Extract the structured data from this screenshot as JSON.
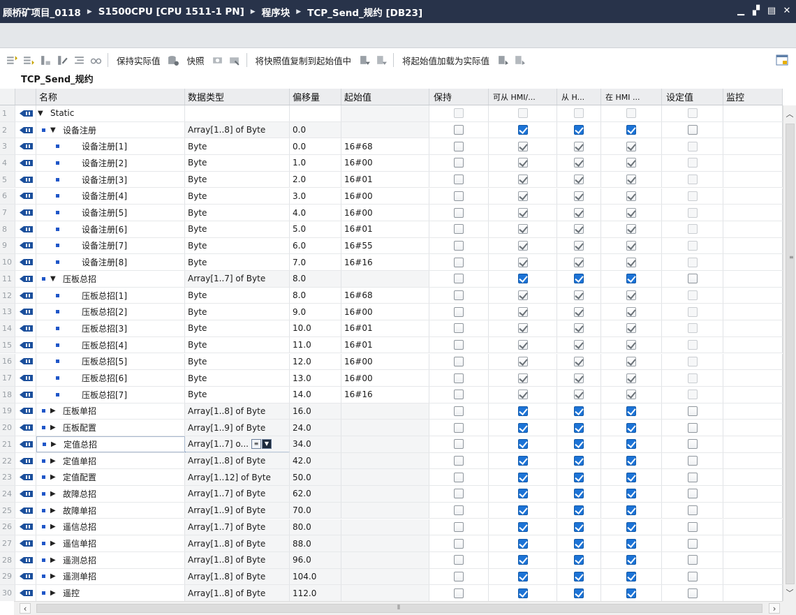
{
  "titlebar": {
    "crumbs": [
      "顾桥矿项目_0118",
      "S1500CPU [CPU 1511-1 PN]",
      "程序块",
      "TCP_Send_规约 [DB23]"
    ]
  },
  "toolbar": {
    "keep_actual": "保持实际值",
    "snapshot": "快照",
    "copy_snapshot": "将快照值复制到起始值中",
    "load_start": "将起始值加载为实际值"
  },
  "block_title": "TCP_Send_规约",
  "columns": [
    "名称",
    "数据类型",
    "偏移量",
    "起始值",
    "保持",
    "可从 HMI/...",
    "从 H...",
    "在 HMI ...",
    "设定值",
    "监控"
  ],
  "rows": [
    {
      "n": "1",
      "level": 0,
      "expand": "down",
      "name": "Static",
      "type": "",
      "off": "",
      "start": "",
      "style": "static"
    },
    {
      "n": "2",
      "level": 1,
      "expand": "down",
      "name": "设备注册",
      "type": "Array[1..8] of Byte",
      "off": "0.0",
      "start": "",
      "style": "parent"
    },
    {
      "n": "3",
      "level": 2,
      "name": "设备注册[1]",
      "type": "Byte",
      "off": "0.0",
      "start": "16#68",
      "style": "child"
    },
    {
      "n": "4",
      "level": 2,
      "name": "设备注册[2]",
      "type": "Byte",
      "off": "1.0",
      "start": "16#00",
      "style": "child"
    },
    {
      "n": "5",
      "level": 2,
      "name": "设备注册[3]",
      "type": "Byte",
      "off": "2.0",
      "start": "16#01",
      "style": "child"
    },
    {
      "n": "6",
      "level": 2,
      "name": "设备注册[4]",
      "type": "Byte",
      "off": "3.0",
      "start": "16#00",
      "style": "child"
    },
    {
      "n": "7",
      "level": 2,
      "name": "设备注册[5]",
      "type": "Byte",
      "off": "4.0",
      "start": "16#00",
      "style": "child"
    },
    {
      "n": "8",
      "level": 2,
      "name": "设备注册[6]",
      "type": "Byte",
      "off": "5.0",
      "start": "16#01",
      "style": "child"
    },
    {
      "n": "9",
      "level": 2,
      "name": "设备注册[7]",
      "type": "Byte",
      "off": "6.0",
      "start": "16#55",
      "style": "child"
    },
    {
      "n": "10",
      "level": 2,
      "name": "设备注册[8]",
      "type": "Byte",
      "off": "7.0",
      "start": "16#16",
      "style": "child"
    },
    {
      "n": "11",
      "level": 1,
      "expand": "down",
      "name": "压板总招",
      "type": "Array[1..7] of Byte",
      "off": "8.0",
      "start": "",
      "style": "parent"
    },
    {
      "n": "12",
      "level": 2,
      "name": "压板总招[1]",
      "type": "Byte",
      "off": "8.0",
      "start": "16#68",
      "style": "child"
    },
    {
      "n": "13",
      "level": 2,
      "name": "压板总招[2]",
      "type": "Byte",
      "off": "9.0",
      "start": "16#00",
      "style": "child"
    },
    {
      "n": "14",
      "level": 2,
      "name": "压板总招[3]",
      "type": "Byte",
      "off": "10.0",
      "start": "16#01",
      "style": "child"
    },
    {
      "n": "15",
      "level": 2,
      "name": "压板总招[4]",
      "type": "Byte",
      "off": "11.0",
      "start": "16#01",
      "style": "child"
    },
    {
      "n": "16",
      "level": 2,
      "name": "压板总招[5]",
      "type": "Byte",
      "off": "12.0",
      "start": "16#00",
      "style": "child"
    },
    {
      "n": "17",
      "level": 2,
      "name": "压板总招[6]",
      "type": "Byte",
      "off": "13.0",
      "start": "16#00",
      "style": "child"
    },
    {
      "n": "18",
      "level": 2,
      "name": "压板总招[7]",
      "type": "Byte",
      "off": "14.0",
      "start": "16#16",
      "style": "child"
    },
    {
      "n": "19",
      "level": 1,
      "expand": "right",
      "name": "压板单招",
      "type": "Array[1..8] of Byte",
      "off": "16.0",
      "start": "",
      "style": "parent"
    },
    {
      "n": "20",
      "level": 1,
      "expand": "right",
      "name": "压板配置",
      "type": "Array[1..9] of Byte",
      "off": "24.0",
      "start": "",
      "style": "parent"
    },
    {
      "n": "21",
      "level": 1,
      "expand": "right",
      "name": "定值总招",
      "type": "Array[1..7] o...",
      "off": "34.0",
      "start": "",
      "style": "parent",
      "selected": true
    },
    {
      "n": "22",
      "level": 1,
      "expand": "right",
      "name": "定值单招",
      "type": "Array[1..8] of Byte",
      "off": "42.0",
      "start": "",
      "style": "parent"
    },
    {
      "n": "23",
      "level": 1,
      "expand": "right",
      "name": "定值配置",
      "type": "Array[1..12] of Byte",
      "off": "50.0",
      "start": "",
      "style": "parent"
    },
    {
      "n": "24",
      "level": 1,
      "expand": "right",
      "name": "故障总招",
      "type": "Array[1..7] of Byte",
      "off": "62.0",
      "start": "",
      "style": "parent"
    },
    {
      "n": "25",
      "level": 1,
      "expand": "right",
      "name": "故障单招",
      "type": "Array[1..9] of Byte",
      "off": "70.0",
      "start": "",
      "style": "parent"
    },
    {
      "n": "26",
      "level": 1,
      "expand": "right",
      "name": "遥信总招",
      "type": "Array[1..7] of Byte",
      "off": "80.0",
      "start": "",
      "style": "parent"
    },
    {
      "n": "27",
      "level": 1,
      "expand": "right",
      "name": "遥信单招",
      "type": "Array[1..8] of Byte",
      "off": "88.0",
      "start": "",
      "style": "parent"
    },
    {
      "n": "28",
      "level": 1,
      "expand": "right",
      "name": "遥测总招",
      "type": "Array[1..8] of Byte",
      "off": "96.0",
      "start": "",
      "style": "parent"
    },
    {
      "n": "29",
      "level": 1,
      "expand": "right",
      "name": "遥测单招",
      "type": "Array[1..8] of Byte",
      "off": "104.0",
      "start": "",
      "style": "parent"
    },
    {
      "n": "30",
      "level": 1,
      "expand": "right",
      "name": "遥控",
      "type": "Array[1..8] of Byte",
      "off": "112.0",
      "start": "",
      "style": "parent"
    }
  ],
  "colors": {
    "titlebar": "#28334a",
    "check_blue": "#1c73d6",
    "bullet_blue": "#1f56c8",
    "db_icon_blue": "#1b4f9c"
  },
  "icons": [
    "db-member-icon",
    "expand-arrow-icon",
    "checkbox-icon",
    "scroll-arrow-icon"
  ]
}
